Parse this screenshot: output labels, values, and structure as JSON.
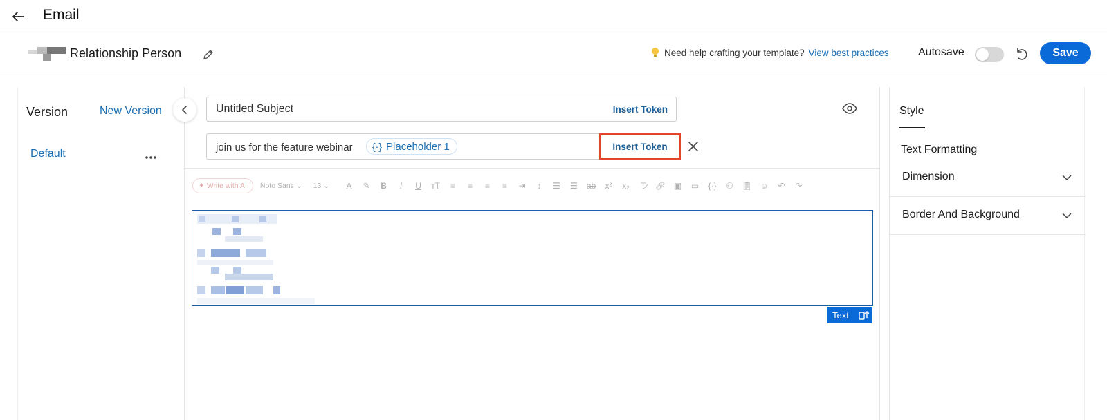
{
  "header": {
    "title": "Email"
  },
  "template": {
    "name": "Relationship Person"
  },
  "help": {
    "text": "Need help crafting your template?",
    "link": "View best practices"
  },
  "autosave": {
    "label": "Autosave",
    "on": false
  },
  "toolbar_top": {
    "save_label": "Save"
  },
  "versions": {
    "title": "Version",
    "new_label": "New Version",
    "items": [
      {
        "label": "Default"
      }
    ]
  },
  "subject": {
    "value": "Untitled Subject",
    "insert_token": "Insert Token"
  },
  "preheader": {
    "value": "join us for the feature webinar",
    "chip": "Placeholder 1",
    "insert_token": "Insert Token"
  },
  "editor_toolbar": {
    "ai_label": "Write with AI",
    "font": "Noto Sans",
    "size": "13"
  },
  "content_block": {
    "tag_label": "Text"
  },
  "right_panel": {
    "tab": "Style",
    "heading": "Text Formatting",
    "sections": [
      {
        "label": "Dimension"
      },
      {
        "label": "Border And Background"
      }
    ]
  },
  "colors": {
    "accent": "#0a6ad8",
    "link": "#1a6fb5",
    "highlight": "#e3452a"
  }
}
